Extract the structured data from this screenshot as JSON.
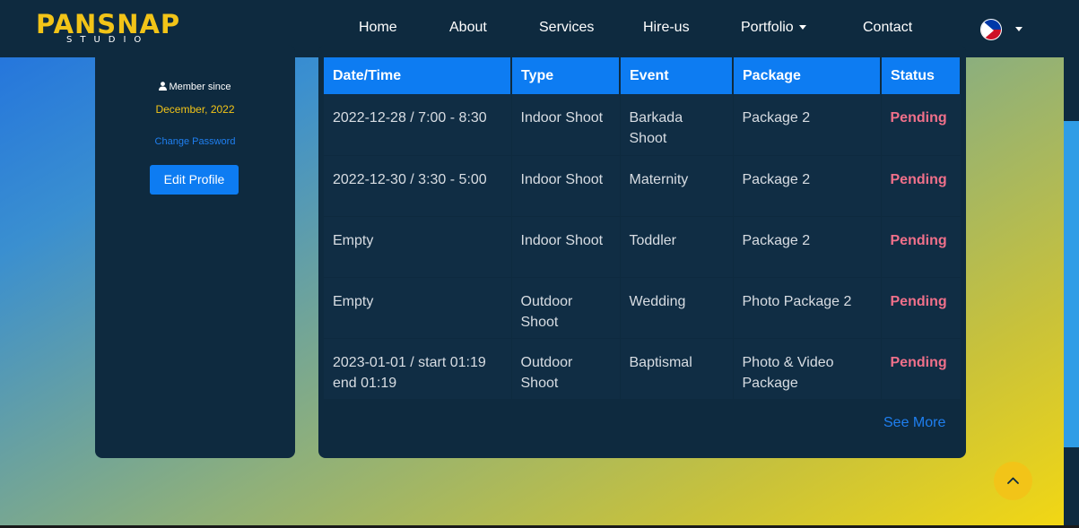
{
  "brand": {
    "name": "PANSNAP",
    "subtitle": "STUDIO"
  },
  "nav": {
    "home": "Home",
    "about": "About",
    "services": "Services",
    "hire_us": "Hire-us",
    "portfolio": "Portfolio",
    "contact": "Contact"
  },
  "profile": {
    "member_since_label": "Member since",
    "member_since_date": "December, 2022",
    "change_password": "Change Password",
    "edit_profile": "Edit Profile"
  },
  "bookings": {
    "columns": [
      "Date/Time",
      "Type",
      "Event",
      "Package",
      "Status"
    ],
    "rows": [
      [
        "2022-12-28 / 7:00 - 8:30",
        "Indoor Shoot",
        "Barkada Shoot",
        "Package 2",
        "Pending"
      ],
      [
        "2022-12-30 / 3:30 - 5:00",
        "Indoor Shoot",
        "Maternity",
        "Package 2",
        "Pending"
      ],
      [
        "Empty",
        "Indoor Shoot",
        "Toddler",
        "Package 2",
        "Pending"
      ],
      [
        "Empty",
        "Outdoor Shoot",
        "Wedding",
        "Photo Package 2",
        "Pending"
      ],
      [
        "2023-01-01 / start 01:19 end 01:19",
        "Outdoor Shoot",
        "Baptismal",
        "Photo & Video Package",
        "Pending"
      ]
    ],
    "see_more": "See More"
  },
  "colors": {
    "nav_bg": "#0e2a3f",
    "accent": "#0d7cf2",
    "brand_yellow": "#f2c418",
    "pending": "#f0708a"
  },
  "icons": {
    "user": "user-icon",
    "caret": "caret-down-icon",
    "flag": "philippines-flag-icon",
    "scroll_top": "chevron-up-icon"
  }
}
